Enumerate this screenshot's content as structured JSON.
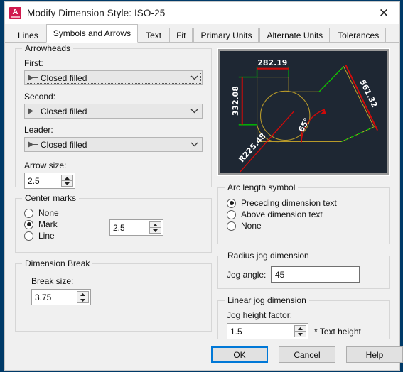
{
  "window": {
    "title": "Modify Dimension Style: ISO-25",
    "icon": "autocad-icon",
    "close_label": "✕"
  },
  "tabs": [
    {
      "label": "Lines",
      "active": false
    },
    {
      "label": "Symbols and Arrows",
      "active": true
    },
    {
      "label": "Text",
      "active": false
    },
    {
      "label": "Fit",
      "active": false
    },
    {
      "label": "Primary Units",
      "active": false
    },
    {
      "label": "Alternate Units",
      "active": false
    },
    {
      "label": "Tolerances",
      "active": false
    }
  ],
  "arrowheads": {
    "legend": "Arrowheads",
    "first_label": "First:",
    "first_value": "Closed filled",
    "second_label": "Second:",
    "second_value": "Closed filled",
    "leader_label": "Leader:",
    "leader_value": "Closed filled",
    "arrow_size_label": "Arrow size:",
    "arrow_size_value": "2.5"
  },
  "center_marks": {
    "legend": "Center marks",
    "options": [
      {
        "label": "None",
        "selected": false
      },
      {
        "label": "Mark",
        "selected": true
      },
      {
        "label": "Line",
        "selected": false
      }
    ],
    "size_value": "2.5"
  },
  "dimension_break": {
    "legend": "Dimension Break",
    "break_size_label": "Break size:",
    "break_size_value": "3.75"
  },
  "arc_length_symbol": {
    "legend": "Arc length symbol",
    "options": [
      {
        "label": "Preceding dimension text",
        "selected": true
      },
      {
        "label": "Above dimension text",
        "selected": false
      },
      {
        "label": "None",
        "selected": false
      }
    ]
  },
  "radius_jog": {
    "legend": "Radius jog dimension",
    "jog_angle_label": "Jog angle:",
    "jog_angle_value": "45"
  },
  "linear_jog": {
    "legend": "Linear jog dimension",
    "jog_height_label": "Jog height factor:",
    "jog_height_value": "1.5",
    "suffix": "* Text height"
  },
  "preview": {
    "background": "#1e2733",
    "geometry_color": "#b89a2a",
    "dimension_color": "#cf0a0a",
    "extension_color": "#00b400",
    "labels": {
      "top": "282.19",
      "left": "332.08",
      "right": "561.32",
      "radius": "R225.48",
      "angle": "65°"
    }
  },
  "footer": {
    "ok": "OK",
    "cancel": "Cancel",
    "help": "Help"
  }
}
